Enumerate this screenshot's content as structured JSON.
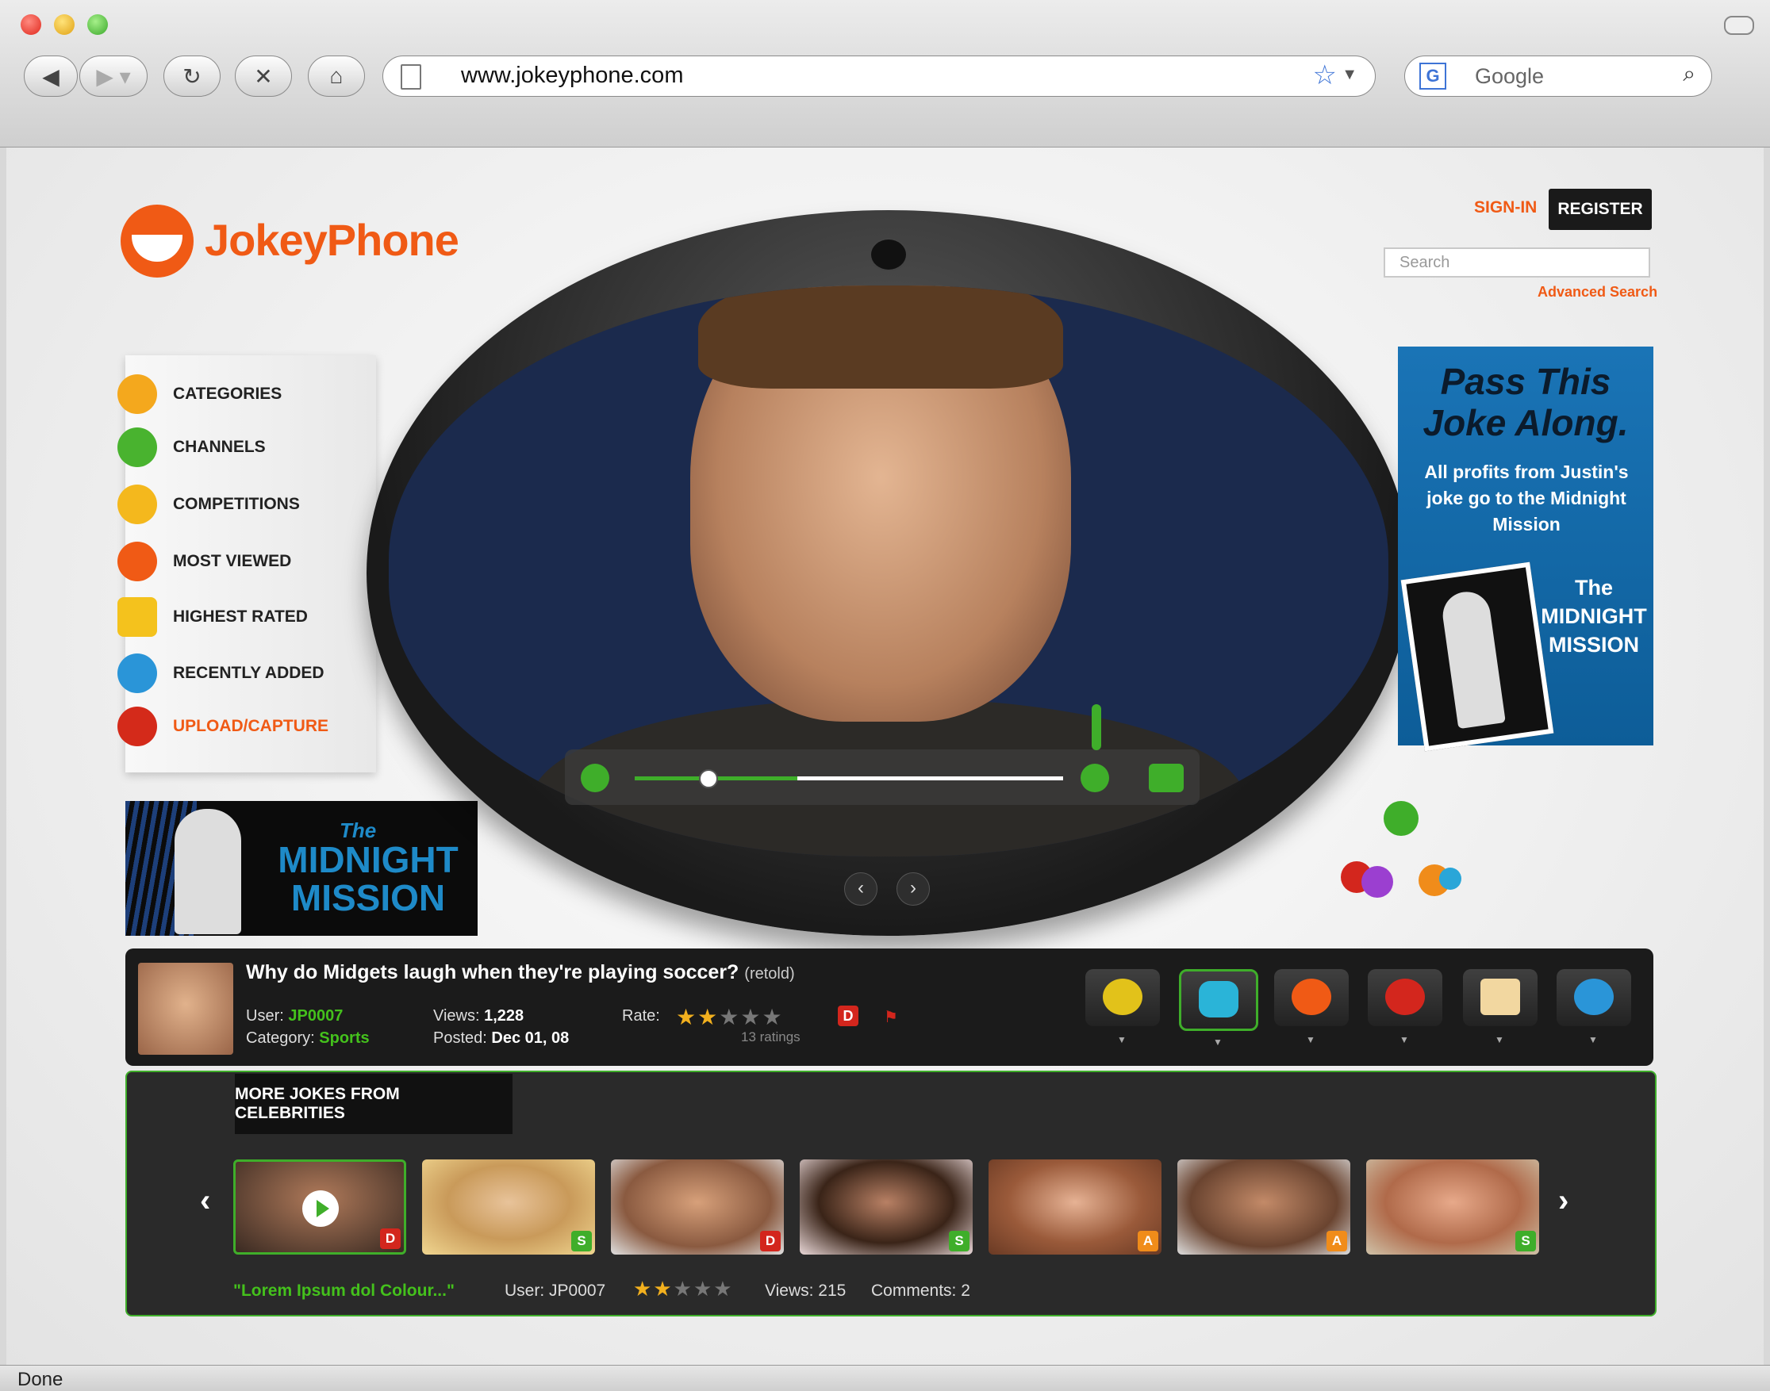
{
  "browser": {
    "url": "www.jokeyphone.com",
    "search_engine_placeholder": "Google",
    "status": "Done"
  },
  "site": {
    "logo_text": "JokeyPhone",
    "sign_in": "SIGN-IN",
    "register": "REGISTER",
    "search_placeholder": "Search",
    "advanced_search": "Advanced Search"
  },
  "menu": [
    {
      "label": "CATEGORIES",
      "icon": "categories-icon",
      "color": "#f4a81d"
    },
    {
      "label": "CHANNELS",
      "icon": "channels-icon",
      "color": "#49b32f"
    },
    {
      "label": "COMPETITIONS",
      "icon": "trophy-icon",
      "color": "#f4b81d"
    },
    {
      "label": "MOST VIEWED",
      "icon": "eyes-icon",
      "color": "#f05a15"
    },
    {
      "label": "HIGHEST RATED",
      "icon": "star-icon",
      "color": "#f4c21d"
    },
    {
      "label": "RECENTLY ADDED",
      "icon": "add-icon",
      "color": "#2a95d8"
    },
    {
      "label": "UPLOAD/CAPTURE",
      "icon": "upload-icon",
      "color": "#d42a1a",
      "highlight": true
    }
  ],
  "banner_left": {
    "the": "The",
    "title": "MIDNIGHT MISSION"
  },
  "ad_right": {
    "headline": "Pass This Joke Along.",
    "body": "All profits from Justin's joke go to the Midnight Mission",
    "caption": "The MIDNIGHT MISSION"
  },
  "player": {
    "progress": 0.38,
    "playhead": 0.15
  },
  "joke": {
    "title": "Why do Midgets laugh when they're playing soccer?",
    "retold": "(retold)",
    "user_label": "User:",
    "user": "JP0007",
    "category_label": "Category:",
    "category": "Sports",
    "views_label": "Views:",
    "views": "1,228",
    "posted_label": "Posted:",
    "posted": "Dec 01, 08",
    "rate_label": "Rate:",
    "rating": 2,
    "rating_max": 5,
    "ratings_count": "13 ratings",
    "badge": "D"
  },
  "action_icons": [
    "share-icon",
    "tv-icon",
    "comment-icon",
    "favorite-icon",
    "message-icon",
    "friends-icon"
  ],
  "more": {
    "heading": "MORE JOKES FROM CELEBRITIES",
    "items": [
      {
        "badge": "D",
        "badge_color": "#d3261d"
      },
      {
        "badge": "S",
        "badge_color": "#3fae2a"
      },
      {
        "badge": "D",
        "badge_color": "#d3261d"
      },
      {
        "badge": "S",
        "badge_color": "#3fae2a"
      },
      {
        "badge": "A",
        "badge_color": "#f08c1a"
      },
      {
        "badge": "A",
        "badge_color": "#f08c1a"
      },
      {
        "badge": "S",
        "badge_color": "#3fae2a"
      }
    ],
    "selected_title": "\"Lorem Ipsum dol Colour...\"",
    "selected_user": "User: JP0007",
    "selected_rating": 2,
    "selected_views": "Views: 215",
    "selected_comments": "Comments: 2"
  },
  "colors": {
    "brand_orange": "#f05a15",
    "accent_green": "#3fae2a"
  }
}
